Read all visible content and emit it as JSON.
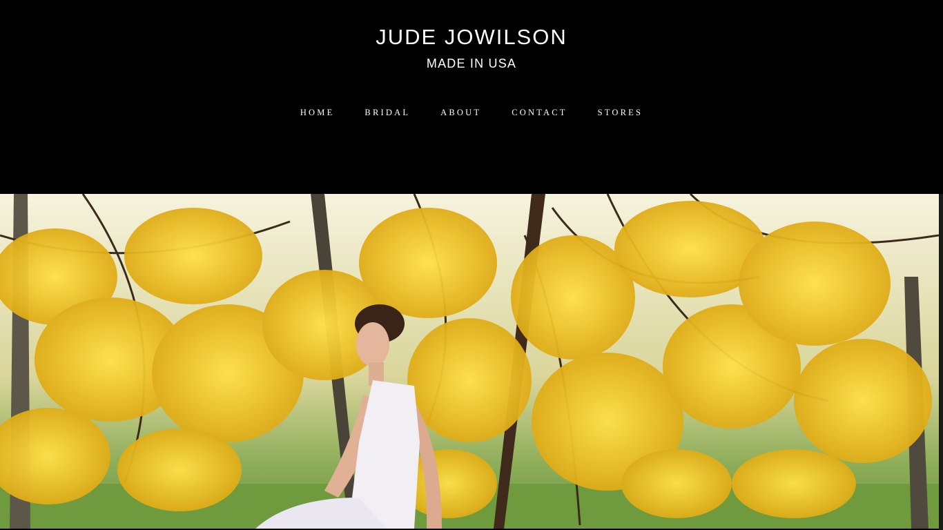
{
  "header": {
    "brand": "JUDE JOWILSON",
    "tagline": "MADE IN USA"
  },
  "nav": {
    "items": [
      {
        "label": "HOME"
      },
      {
        "label": "BRIDAL"
      },
      {
        "label": "ABOUT"
      },
      {
        "label": "CONTACT"
      },
      {
        "label": "STORES"
      }
    ]
  },
  "colors": {
    "background": "#000000",
    "text": "#ffffff",
    "foliage": "#f2c21a",
    "grass": "#6f9a3e"
  }
}
